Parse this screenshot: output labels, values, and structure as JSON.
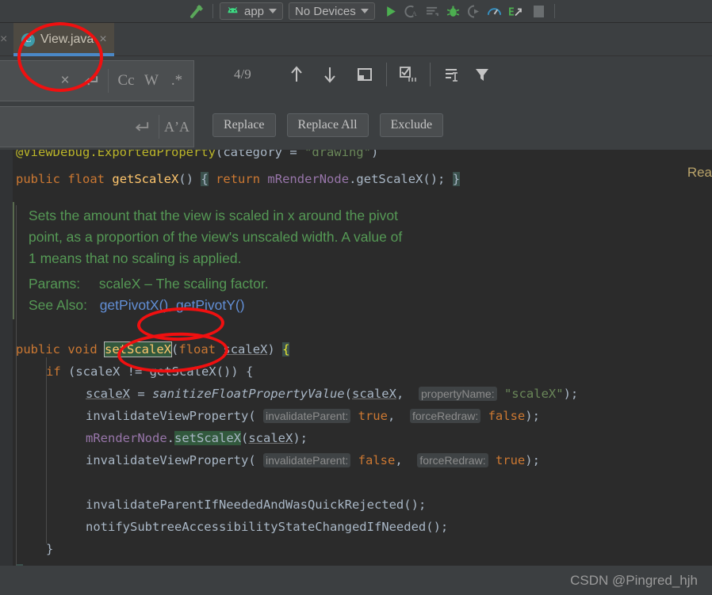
{
  "toolbar": {
    "icons": [
      {
        "name": "build-hammer-icon",
        "glyph": "hammer"
      },
      {
        "name": "run-configuration-app",
        "label": "app",
        "caret": "▾"
      },
      {
        "name": "device-selector",
        "label": "No Devices",
        "caret": "▾"
      },
      {
        "name": "run-icon",
        "glyph": "play"
      },
      {
        "name": "code-analyze-icon",
        "glyph": "CA"
      },
      {
        "name": "app-inspection-icon",
        "glyph": "lines"
      },
      {
        "name": "debug-icon",
        "glyph": "bug"
      },
      {
        "name": "profile-icon",
        "glyph": "moon-play"
      },
      {
        "name": "profiler-icon",
        "glyph": "gauge"
      },
      {
        "name": "run-with-coverage-icon",
        "glyph": "coverage"
      },
      {
        "name": "stop-icon",
        "glyph": "stop"
      }
    ],
    "app_label": "app",
    "device_label": "No Devices"
  },
  "tabs": {
    "items": [
      {
        "label": "View.java",
        "icon": "C",
        "active": true,
        "close": "×"
      }
    ],
    "left_close": "×"
  },
  "find": {
    "row1": {
      "clear_icon": "×",
      "newline_icon": "↵",
      "match_case": "Cc",
      "words": "W",
      "regex": ".*"
    },
    "row2": {
      "newline_icon": "↵",
      "preserve_case": "AʼA"
    },
    "count": "4/9",
    "nav": {
      "prev": "↑",
      "next": "↓",
      "select_all_occurrences": "open-in-new-window-icon",
      "multiline": "multiline-icon",
      "filter_in_selection": "filter-in-selection-icon",
      "filter": "filter-icon"
    },
    "buttons": {
      "replace": "Replace",
      "replace_all": "Replace All",
      "exclude": "Exclude"
    }
  },
  "editor": {
    "right_hint": "Rea",
    "lines": {
      "annotation": {
        "at": "@",
        "viewdebug": "ViewDebug",
        "dot": ".",
        "exported": "ExportedProperty",
        "open": "(category = ",
        "value": "\"drawing\"",
        "close": ")"
      },
      "getter": {
        "modifier": "public",
        "type": "float",
        "name": "getScaleX",
        "parens": "()",
        "brace_open": "{",
        "return_kw": "return",
        "field": "mRenderNode",
        "dot": ".",
        "call": "getScaleX();",
        "brace_close": "}"
      }
    },
    "javadoc": {
      "body": "Sets the amount that the view is scaled in x around the pivot point, as a proportion of the view's unscaled width. A value of 1 means that no scaling is applied.",
      "body_l1": "Sets the amount that the view is scaled in x around the pivot",
      "body_l2": "point, as a proportion of the view's unscaled width. A value of",
      "body_l3": "1 means that no scaling is applied.",
      "params_label": "Params:",
      "params_value": "scaleX – The scaling factor.",
      "seealso_label": "See Also:",
      "seealso_links": [
        "getPivotX()",
        "getPivotY()"
      ],
      "seealso_sep": ", "
    },
    "code": {
      "l_sig_public": "public",
      "l_sig_void": "void",
      "l_sig_name": "setScaleX",
      "l_sig_open": "(",
      "l_sig_type": "float",
      "l_sig_param": "scaleX",
      "l_sig_close": ")",
      "l_sig_brace": "{",
      "l_if_kw": "if",
      "l_if_rest": " (scaleX != getScaleX()) {",
      "l_assign_var": "scaleX",
      "l_assign_eq": " = ",
      "l_assign_call": "sanitizeFloatPropertyValue",
      "l_assign_open": "(",
      "l_assign_arg": "scaleX",
      "l_assign_comma": ", ",
      "l_assign_hint": "propertyName:",
      "l_assign_str": "\"scaleX\"",
      "l_assign_end": ");",
      "l_inv1_name": "invalidateViewProperty",
      "l_inv1_open": "(",
      "l_inv1_hint1": "invalidateParent:",
      "l_inv1_v1": "true",
      "l_inv1_comma": ", ",
      "l_inv1_hint2": "forceRedraw:",
      "l_inv1_v2": "false",
      "l_inv1_end": ");",
      "l_rn_field": "mRenderNode",
      "l_rn_dot": ".",
      "l_rn_call": "setScaleX",
      "l_rn_open": "(",
      "l_rn_arg": "scaleX",
      "l_rn_end": ");",
      "l_inv2_name": "invalidateViewProperty",
      "l_inv2_open": "(",
      "l_inv2_hint1": "invalidateParent:",
      "l_inv2_v1": "false",
      "l_inv2_comma": ", ",
      "l_inv2_hint2": "forceRedraw:",
      "l_inv2_v2": "true",
      "l_inv2_end": ");",
      "l_quick": "invalidateParentIfNeededAndWasQuickRejected",
      "l_quick_end": "();",
      "l_notify": "notifySubtreeAccessibilityStateChangedIfNeeded",
      "l_notify_end": "();",
      "l_close_inner": "}",
      "l_close_outer": "}"
    }
  },
  "bottom": {
    "watermark": "CSDN @Pingred_hjh"
  },
  "annotations": {
    "ellipse_color": "#f01010",
    "ellipses": [
      "tab-view-java",
      "see-also-pivot-links",
      "method-signature-setscalex"
    ]
  },
  "colors": {
    "editor_bg": "#2b2b2b",
    "chrome_bg": "#3c3f41",
    "tab_active_bg": "#4e4a42",
    "tab_underline": "#4a88c7",
    "keyword": "#cc7832",
    "method": "#ffc66d",
    "field": "#9876aa",
    "string": "#6a8759",
    "annotation": "#bbb529",
    "javadoc_text": "#559955",
    "javadoc_link": "#628fd6",
    "match_highlight": "#32593d",
    "default_text": "#a9b7c6"
  }
}
